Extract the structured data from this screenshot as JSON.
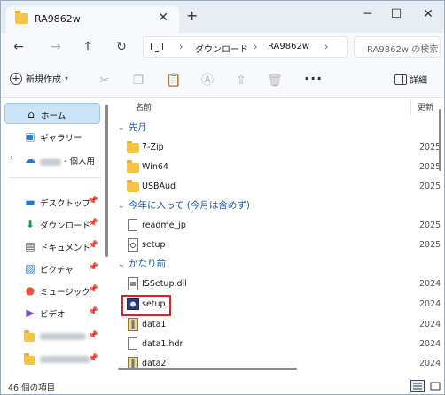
{
  "window": {
    "tab_title": "RA9862w"
  },
  "address": {
    "crumbs": [
      "ダウンロード",
      "RA9862w"
    ],
    "search_placeholder": "RA9862w の検索"
  },
  "commandbar": {
    "new_label": "新規作成",
    "details_label": "詳細"
  },
  "sidebar": {
    "home": "ホーム",
    "gallery": "ギャラリー",
    "onedrive_suffix": "- 個人用",
    "quick": [
      {
        "label": "デスクトップ",
        "icon": "desktop-icon"
      },
      {
        "label": "ダウンロード",
        "icon": "download-icon"
      },
      {
        "label": "ドキュメント",
        "icon": "document-icon"
      },
      {
        "label": "ピクチャ",
        "icon": "picture-icon"
      },
      {
        "label": "ミュージック",
        "icon": "music-icon"
      },
      {
        "label": "ビデオ",
        "icon": "video-icon"
      }
    ]
  },
  "filelist": {
    "col_name": "名前",
    "col_date": "更新",
    "groups": [
      {
        "label": "先月",
        "items": [
          "7-Zip",
          "Win64",
          "USBAud"
        ]
      },
      {
        "label": "今年に入って (今月は含めず)",
        "items": [
          "readme_jp",
          "setup"
        ]
      },
      {
        "label": "かなり前",
        "items": [
          "ISSetup.dll",
          "setup",
          "data1",
          "data1.hdr",
          "data2"
        ]
      }
    ],
    "date_prefix_recent": "2025",
    "date_prefix_old": "2024"
  },
  "status": {
    "count": "46 個の項目"
  },
  "colors": {
    "accent": "#1a5fb4",
    "highlight": "#e02020",
    "folder": "#f4c542",
    "selected": "#cce4f7"
  }
}
